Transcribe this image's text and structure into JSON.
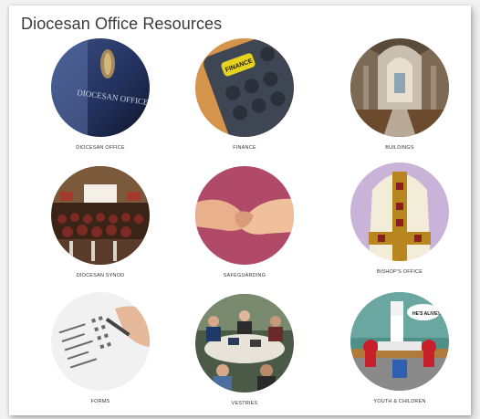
{
  "section": {
    "title": "Diocesan Office Resources"
  },
  "tiles": [
    {
      "label": "DIOCESAN OFFICE",
      "icon": "diocesan-office-photo",
      "sign_text": "DIOCESAN OFFICE"
    },
    {
      "label": "FINANCE",
      "icon": "calculator-photo",
      "key_text": "FINANCE"
    },
    {
      "label": "BUILDINGS",
      "icon": "church-interior-photo"
    },
    {
      "label": "DIOCESAN SYNOD",
      "icon": "synod-hall-photo"
    },
    {
      "label": "SAFEGUARDING",
      "icon": "holding-hands-photo"
    },
    {
      "label": "BISHOP'S OFFICE",
      "icon": "mitre-photo"
    },
    {
      "label": "FORMS",
      "icon": "form-writing-photo"
    },
    {
      "label": "VESTRIES",
      "icon": "meeting-table-photo"
    },
    {
      "label": "YOUTH & CHILDREN",
      "icon": "lego-scene-photo",
      "speech_text": "HE'S ALIVE!!"
    }
  ],
  "colors": {
    "background": "#f2f2f2",
    "panel": "#ffffff",
    "title_text": "#3b3b3b",
    "caption_text": "#333333"
  }
}
